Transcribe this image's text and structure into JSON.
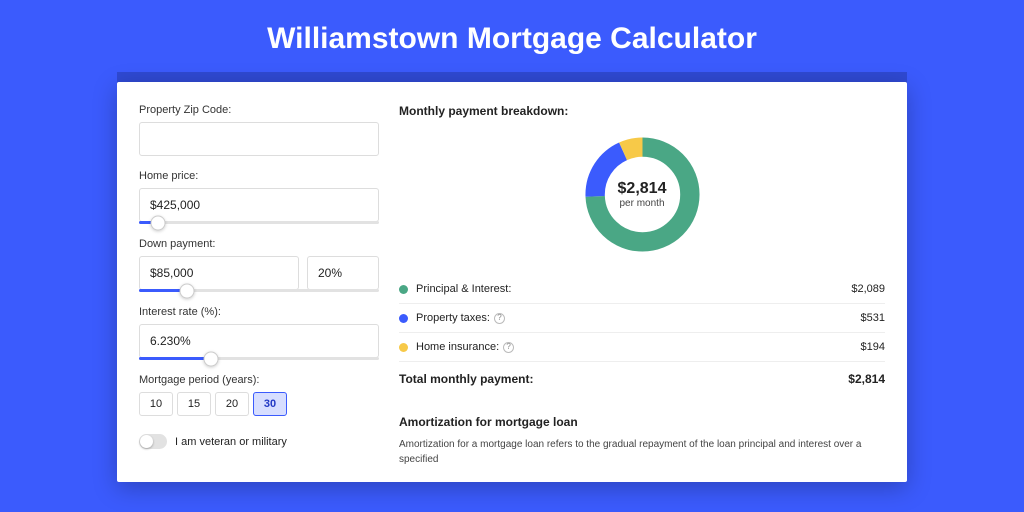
{
  "page_title": "Williamstown Mortgage Calculator",
  "form": {
    "zip": {
      "label": "Property Zip Code:",
      "value": ""
    },
    "home_price": {
      "label": "Home price:",
      "value": "$425,000",
      "slider_pct": 8
    },
    "down_payment": {
      "label": "Down payment:",
      "value": "$85,000",
      "percent": "20%",
      "slider_pct": 20
    },
    "interest_rate": {
      "label": "Interest rate (%):",
      "value": "6.230%",
      "slider_pct": 30
    },
    "period": {
      "label": "Mortgage period (years):",
      "options": [
        "10",
        "15",
        "20",
        "30"
      ],
      "active": "30"
    },
    "veteran": {
      "label": "I am veteran or military",
      "checked": false
    }
  },
  "breakdown": {
    "title": "Monthly payment breakdown:",
    "donut": {
      "value": "$2,814",
      "sub": "per month"
    },
    "items": [
      {
        "color": "green",
        "label": "Principal & Interest:",
        "value": "$2,089",
        "info": false
      },
      {
        "color": "blue",
        "label": "Property taxes:",
        "value": "$531",
        "info": true
      },
      {
        "color": "yellow",
        "label": "Home insurance:",
        "value": "$194",
        "info": true
      }
    ],
    "total": {
      "label": "Total monthly payment:",
      "value": "$2,814"
    }
  },
  "amortization": {
    "title": "Amortization for mortgage loan",
    "text": "Amortization for a mortgage loan refers to the gradual repayment of the loan principal and interest over a specified"
  },
  "chart_data": {
    "type": "pie",
    "title": "Monthly payment breakdown",
    "series": [
      {
        "name": "Principal & Interest",
        "value": 2089,
        "color": "#4AA785"
      },
      {
        "name": "Property taxes",
        "value": 531,
        "color": "#3B5BFD"
      },
      {
        "name": "Home insurance",
        "value": 194,
        "color": "#F7C948"
      }
    ],
    "total": 2814,
    "center_label": "$2,814 per month"
  }
}
